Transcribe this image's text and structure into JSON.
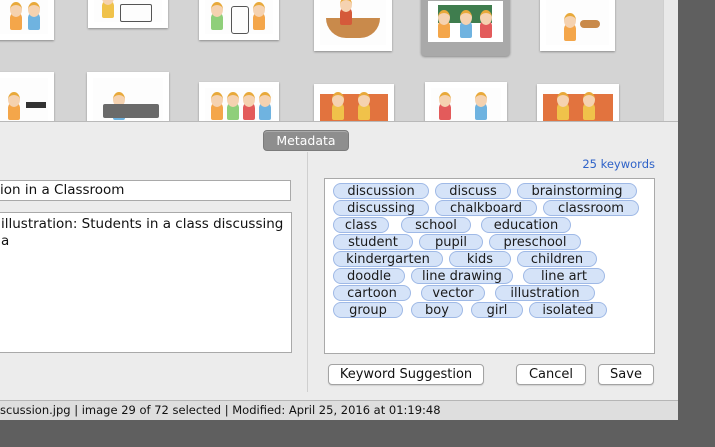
{
  "metadata_tab": "Metadata",
  "title_field": {
    "value": "ion in a Classroom"
  },
  "description_field": {
    "value": " illustration: Students in a class discussing a"
  },
  "keywords": {
    "count_label": "25 keywords",
    "items": [
      "discussion",
      "discuss",
      "brainstorming",
      "discussing",
      "chalkboard",
      "classroom",
      "class",
      "school",
      "education",
      "student",
      "pupil",
      "preschool",
      "kindergarten",
      "kids",
      "children",
      "doodle",
      "line drawing",
      "line art",
      "cartoon",
      "vector",
      "illustration",
      "group",
      "boy",
      "girl",
      "isolated"
    ]
  },
  "buttons": {
    "keyword_suggestion": "Keyword Suggestion",
    "cancel": "Cancel",
    "save": "Save"
  },
  "status_bar": "scussion.jpg | image 29 of 72 selected | Modified: April 25, 2016 at 01:19:48"
}
